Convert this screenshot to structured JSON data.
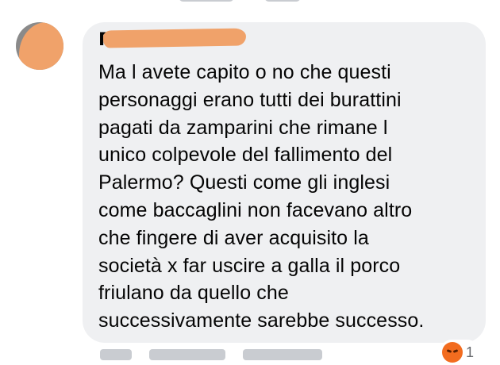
{
  "comment": {
    "author_initial": "F",
    "text": "Ma l avete capito o no che questi\npersonaggi erano tutti dei burattini\npagati da zamparini che rimane l\nunico colpevole del fallimento del\nPalermo? Questi come gli inglesi\ncome baccaglini non facevano altro\nche fingere di aver acquisito la\nsocietà  x far uscire a galla il porco\nfriulano da quello che\nsuccessivamente sarebbe successo."
  },
  "reactions": {
    "icon": "angry-reaction-icon",
    "count": "1"
  },
  "colors": {
    "bubble": "#eff0f2",
    "redaction": "#f0a26a",
    "text": "#050505",
    "reaction": "#f26c1f"
  }
}
